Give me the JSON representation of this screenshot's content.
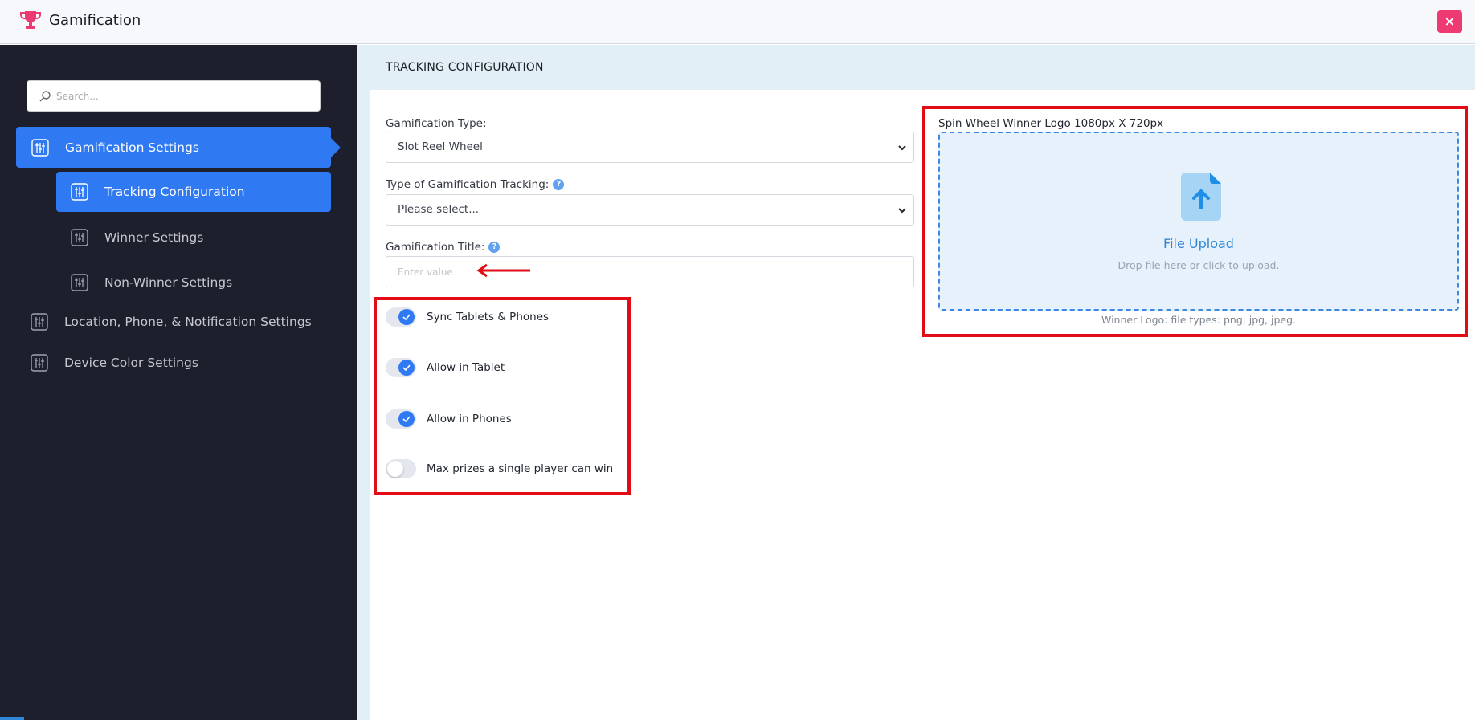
{
  "header": {
    "app_title": "Gamification",
    "close_label": "×",
    "trophy_color": "#ee3a73"
  },
  "sidebar": {
    "search_placeholder": "Search...",
    "items": [
      {
        "label": "Gamification Settings",
        "icon": "sliders-icon",
        "active": true,
        "level": 0
      },
      {
        "label": "Tracking Configuration",
        "icon": "sliders-icon",
        "active": true,
        "level": 1
      },
      {
        "label": "Winner Settings",
        "icon": "sliders-icon",
        "active": false,
        "level": 1
      },
      {
        "label": "Non-Winner Settings",
        "icon": "sliders-icon",
        "active": false,
        "level": 1
      },
      {
        "label": "Location, Phone, & Notification Settings",
        "icon": "sliders-icon",
        "active": false,
        "level": 0
      },
      {
        "label": "Device Color Settings",
        "icon": "sliders-icon",
        "active": false,
        "level": 0
      }
    ]
  },
  "main": {
    "section_title": "TRACKING CONFIGURATION",
    "gamification_type": {
      "label": "Gamification Type:",
      "value": "Slot Reel Wheel"
    },
    "tracking_type": {
      "label": "Type of Gamification Tracking:",
      "value": "Please select...",
      "help": "?"
    },
    "gamification_title": {
      "label": "Gamification Title:",
      "placeholder": "Enter value",
      "value": "",
      "help": "?"
    },
    "toggles": [
      {
        "label": "Sync Tablets & Phones",
        "on": true
      },
      {
        "label": "Allow in Tablet",
        "on": true
      },
      {
        "label": "Allow in Phones",
        "on": true
      },
      {
        "label": "Max prizes a single player can win",
        "on": false
      }
    ],
    "upload": {
      "label": "Spin Wheel Winner Logo 1080px X 720px",
      "title": "File Upload",
      "hint": "Drop file here or click to upload.",
      "note": "Winner Logo: file types: png, jpg, jpeg."
    }
  },
  "colors": {
    "accent": "#2f7af2",
    "sidebar_bg": "#1e1f2c",
    "highlight_red": "#e10c16",
    "close_btn": "#ee3a73"
  }
}
